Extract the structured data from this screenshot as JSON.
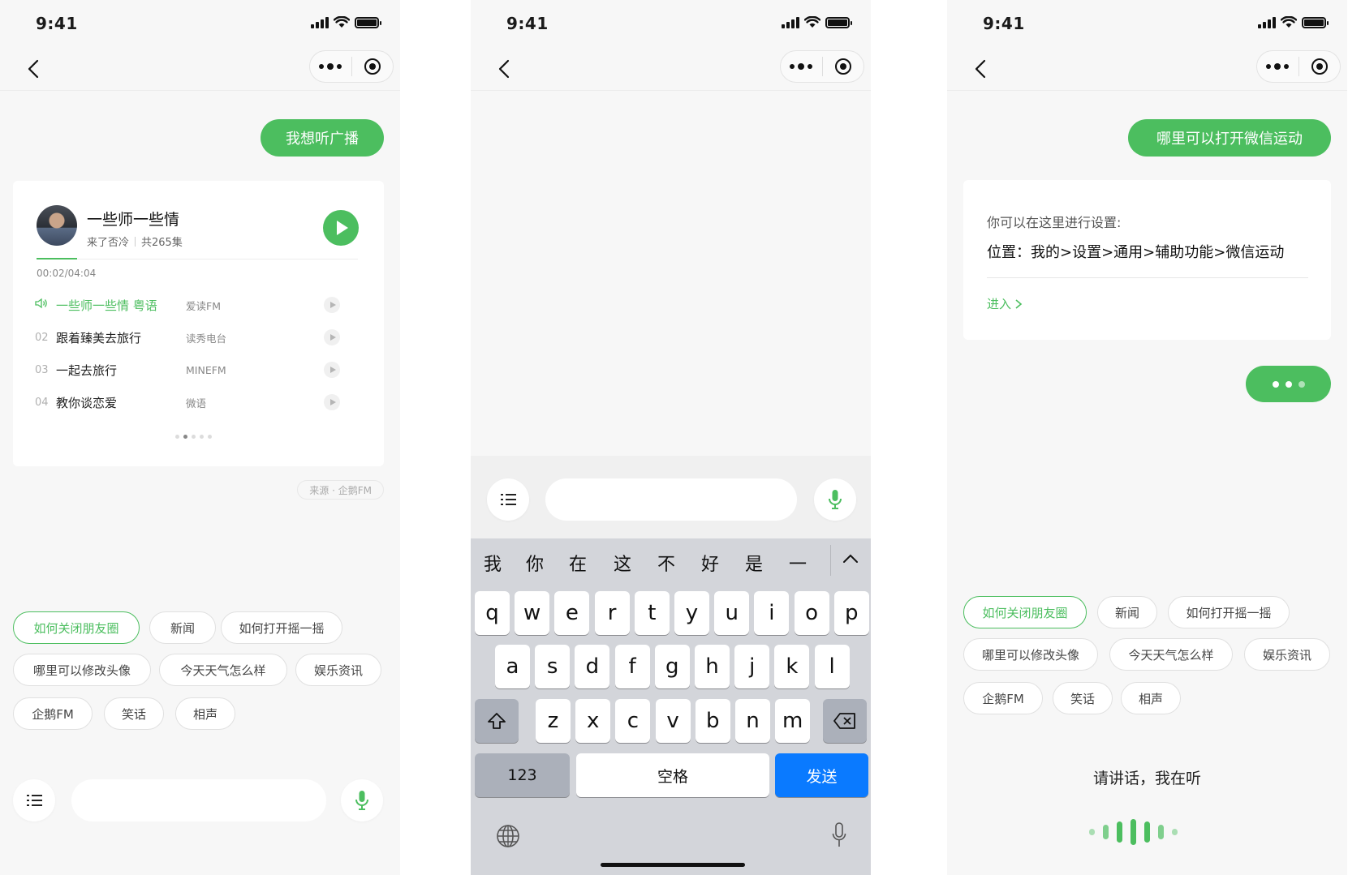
{
  "colors": {
    "accent": "#4cbe5f",
    "keyboard_send": "#0a7aff",
    "background": "#f7f7f7"
  },
  "screens": [
    {
      "status_time": "9:41",
      "user_message": "我想听广播",
      "music": {
        "title": "一些师一些情",
        "subtitle": "来了否冷",
        "episodes": "共265集",
        "time": "00:02/04:04",
        "progress_fraction": 0.008,
        "tracks": [
          {
            "num": "",
            "name": "一些师一些情 粤语",
            "source": "爱读FM",
            "playing": true
          },
          {
            "num": "02",
            "name": "跟着臻美去旅行",
            "source": "读秀电台",
            "playing": false
          },
          {
            "num": "03",
            "name": "一起去旅行",
            "source": "MINEFM",
            "playing": false
          },
          {
            "num": "04",
            "name": "教你谈恋爱",
            "source": "微语",
            "playing": false
          }
        ],
        "page_index": 1,
        "page_count": 5
      },
      "source_tag": "来源 · 企鹅FM",
      "suggestions": [
        "如何关闭朋友圈",
        "新闻",
        "如何打开摇一摇",
        "哪里可以修改头像",
        "今天天气怎么样",
        "娱乐资讯",
        "企鹅FM",
        "笑话",
        "相声"
      ]
    },
    {
      "status_time": "9:41",
      "keyboard": {
        "candidates": [
          "我",
          "你",
          "在",
          "这",
          "不",
          "好",
          "是",
          "一"
        ],
        "row1": [
          "q",
          "w",
          "e",
          "r",
          "t",
          "y",
          "u",
          "i",
          "o",
          "p"
        ],
        "row2": [
          "a",
          "s",
          "d",
          "f",
          "g",
          "h",
          "j",
          "k",
          "l"
        ],
        "row3": [
          "z",
          "x",
          "c",
          "v",
          "b",
          "n",
          "m"
        ],
        "numbers_key": "123",
        "space_key": "空格",
        "send_key": "发送"
      }
    },
    {
      "status_time": "9:41",
      "user_message": "哪里可以打开微信运动",
      "answer": {
        "intro": "你可以在这里进行设置:",
        "path": "位置：我的>设置>通用>辅助功能>微信运动",
        "link": "进入"
      },
      "suggestions": [
        "如何关闭朋友圈",
        "新闻",
        "如何打开摇一摇",
        "哪里可以修改头像",
        "今天天气怎么样",
        "娱乐资讯",
        "企鹅FM",
        "笑话",
        "相声"
      ],
      "listening_hint": "请讲话，我在听"
    }
  ]
}
